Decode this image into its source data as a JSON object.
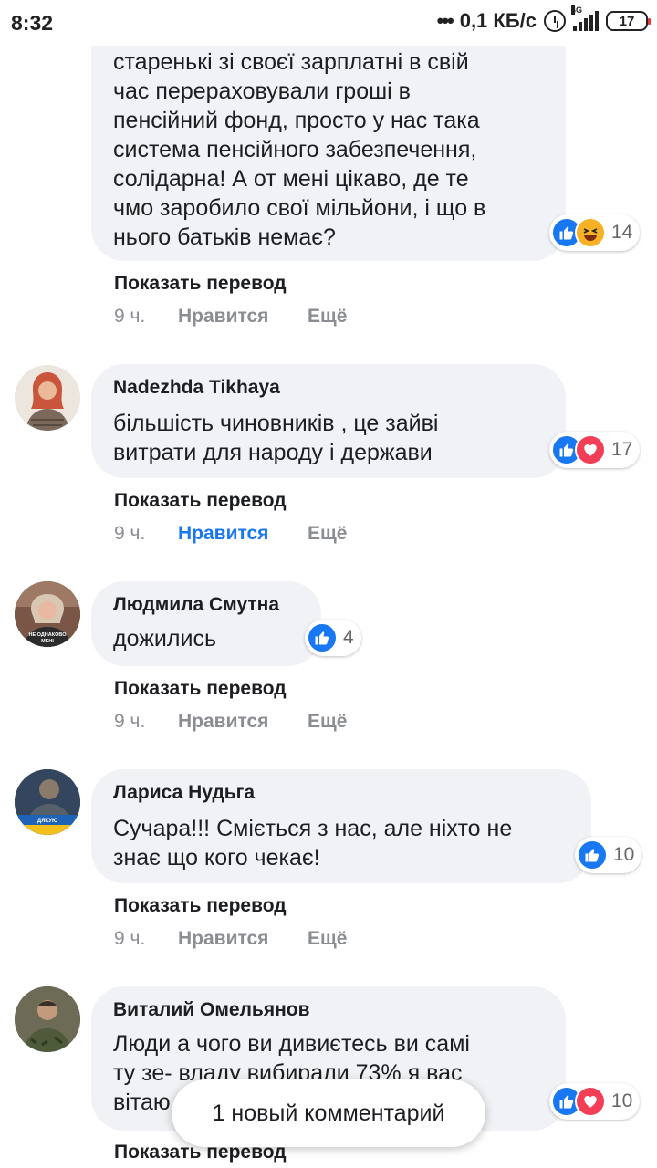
{
  "status_bar": {
    "time": "8:32",
    "network_speed": "0,1 КБ/с",
    "network_type": "4G",
    "battery": "17"
  },
  "comments": [
    {
      "author": "",
      "text_lines": [
        "старенькі зі своєї зарплатні в свій",
        "час перераховували гроші в",
        "пенсійний фонд, просто у нас така",
        "система пенсійного забезпечення,",
        "солідарна! А от мені цікаво, де те",
        "чмо заробило свої мільйони, і що в",
        "нього батьків немає?"
      ],
      "reactions": [
        "like-icon",
        "haha-icon"
      ],
      "reaction_count": "14",
      "translate": "Показать перевод",
      "time": "9 ч.",
      "like": "Нравится",
      "more": "Ещё",
      "liked": false
    },
    {
      "author": "Nadezhda Tikhaya",
      "text_lines": [
        "більшість чиновників , це зайві",
        "витрати для народу і держави"
      ],
      "reactions": [
        "like-icon",
        "love-icon"
      ],
      "reaction_count": "17",
      "translate": "Показать перевод",
      "time": "9 ч.",
      "like": "Нравится",
      "more": "Ещё",
      "liked": true
    },
    {
      "author": "Людмила Смутна",
      "text_lines": [
        "дожились"
      ],
      "reactions": [
        "like-icon"
      ],
      "reaction_count": "4",
      "translate": "Показать перевод",
      "time": "9 ч.",
      "like": "Нравится",
      "more": "Ещё",
      "liked": false,
      "avatar_caption": "НЕ ОДНАКОВО МЕНІ"
    },
    {
      "author": "Лариса Нудьга",
      "text_lines": [
        "Сучара!!! Сміється з нас, але ніхто не",
        "знає що кого чекає!"
      ],
      "reactions": [
        "like-icon"
      ],
      "reaction_count": "10",
      "translate": "Показать перевод",
      "time": "9 ч.",
      "like": "Нравится",
      "more": "Ещё",
      "liked": false
    },
    {
      "author": "Виталий Омельянов",
      "text_lines": [
        "Люди а чого ви дивиєтесь ви самі",
        "ту зе- владу вибирали 73% я вас",
        "вітаю"
      ],
      "reactions": [
        "like-icon",
        "love-icon"
      ],
      "reaction_count": "10",
      "translate": "Показать перевод"
    }
  ],
  "new_comment_toast": "1 новый комментарий",
  "colors": {
    "bubble": "#f0f2f5",
    "accent": "#1877f2",
    "love": "#f33e58",
    "haha": "#f7b125",
    "muted": "#8a8d91"
  }
}
